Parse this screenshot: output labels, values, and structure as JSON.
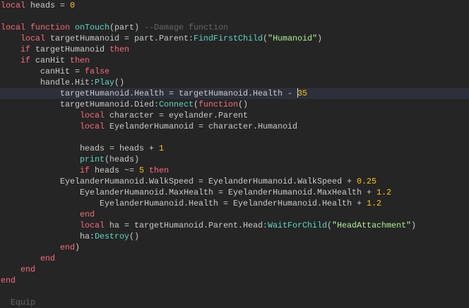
{
  "editor": {
    "cursor_line": 8,
    "lines": [
      {
        "indent": 0,
        "tokens": [
          [
            "local",
            "kw"
          ],
          [
            " heads = ",
            "txt"
          ],
          [
            "0",
            "num"
          ]
        ]
      },
      {
        "indent": 0,
        "tokens": []
      },
      {
        "indent": 0,
        "tokens": [
          [
            "local function ",
            "kw"
          ],
          [
            "onTouch",
            "fn"
          ],
          [
            "(part) ",
            "txt"
          ],
          [
            "--Damage function",
            "cm"
          ]
        ]
      },
      {
        "indent": 4,
        "tokens": [
          [
            "local",
            "kw"
          ],
          [
            " targetHumanoid = part.Parent:",
            "txt"
          ],
          [
            "FindFirstChild",
            "fn"
          ],
          [
            "(",
            "txt"
          ],
          [
            "\"Humanoid\"",
            "str"
          ],
          [
            ")",
            "txt"
          ]
        ]
      },
      {
        "indent": 4,
        "tokens": [
          [
            "if",
            "kw"
          ],
          [
            " targetHumanoid ",
            "txt"
          ],
          [
            "then",
            "kw"
          ]
        ]
      },
      {
        "indent": 4,
        "tokens": [
          [
            "if",
            "kw"
          ],
          [
            " canHit ",
            "txt"
          ],
          [
            "then",
            "kw"
          ]
        ]
      },
      {
        "indent": 8,
        "tokens": [
          [
            "canHit = ",
            "txt"
          ],
          [
            "false",
            "kw"
          ]
        ]
      },
      {
        "indent": 8,
        "tokens": [
          [
            "handle.Hit:",
            "txt"
          ],
          [
            "Play",
            "fn"
          ],
          [
            "()",
            "txt"
          ]
        ]
      },
      {
        "indent": 12,
        "tokens": [
          [
            "targetHumanoid.Health = targetHumanoid.Health - ",
            "txt"
          ],
          [
            "|",
            ""
          ],
          [
            "35",
            "num"
          ]
        ]
      },
      {
        "indent": 12,
        "tokens": [
          [
            "targetHumanoid.Died:",
            "txt"
          ],
          [
            "Connect",
            "fn"
          ],
          [
            "(",
            "txt"
          ],
          [
            "function",
            "kw"
          ],
          [
            "()",
            "txt"
          ]
        ]
      },
      {
        "indent": 16,
        "tokens": [
          [
            "local",
            "kw"
          ],
          [
            " character = eyelander.Parent",
            "txt"
          ]
        ]
      },
      {
        "indent": 16,
        "tokens": [
          [
            "local",
            "kw"
          ],
          [
            " EyelanderHumanoid = character.Humanoid",
            "txt"
          ]
        ]
      },
      {
        "indent": 0,
        "tokens": []
      },
      {
        "indent": 16,
        "tokens": [
          [
            "heads = heads + ",
            "txt"
          ],
          [
            "1",
            "num"
          ]
        ]
      },
      {
        "indent": 16,
        "tokens": [
          [
            "print",
            "fn"
          ],
          [
            "(heads)",
            "txt"
          ]
        ]
      },
      {
        "indent": 16,
        "tokens": [
          [
            "if",
            "kw"
          ],
          [
            " heads ~= ",
            "txt"
          ],
          [
            "5",
            "num"
          ],
          [
            " ",
            "txt"
          ],
          [
            "then",
            "kw"
          ]
        ]
      },
      {
        "indent": 12,
        "tokens": [
          [
            "EyelanderHumanoid.WalkSpeed = EyelanderHumanoid.WalkSpeed + ",
            "txt"
          ],
          [
            "0.25",
            "num"
          ]
        ]
      },
      {
        "indent": 16,
        "tokens": [
          [
            "EyelanderHumanoid.MaxHealth = EyelanderHumanoid.MaxHealth + ",
            "txt"
          ],
          [
            "1.2",
            "num"
          ]
        ]
      },
      {
        "indent": 20,
        "tokens": [
          [
            "EyelanderHumanoid.Health = EyelanderHumanoid.Health + ",
            "txt"
          ],
          [
            "1.2",
            "num"
          ]
        ]
      },
      {
        "indent": 16,
        "tokens": [
          [
            "end",
            "kw"
          ]
        ]
      },
      {
        "indent": 16,
        "tokens": [
          [
            "local",
            "kw"
          ],
          [
            " ha = targetHumanoid.Parent.Head:",
            "txt"
          ],
          [
            "WaitForChild",
            "fn"
          ],
          [
            "(",
            "txt"
          ],
          [
            "\"HeadAttachment\"",
            "str"
          ],
          [
            ")",
            "txt"
          ]
        ]
      },
      {
        "indent": 16,
        "tokens": [
          [
            "ha:",
            "txt"
          ],
          [
            "Destroy",
            "fn"
          ],
          [
            "()",
            "txt"
          ]
        ]
      },
      {
        "indent": 12,
        "tokens": [
          [
            "end",
            "kw"
          ],
          [
            ")",
            "txt"
          ]
        ]
      },
      {
        "indent": 8,
        "tokens": [
          [
            "end",
            "kw"
          ]
        ]
      },
      {
        "indent": 4,
        "tokens": [
          [
            "end",
            "kw"
          ]
        ]
      },
      {
        "indent": 0,
        "tokens": [
          [
            "end",
            "kw"
          ]
        ]
      },
      {
        "indent": 0,
        "tokens": []
      },
      {
        "indent": 2,
        "tokens": [
          [
            "Equip",
            "cm"
          ]
        ]
      }
    ]
  }
}
